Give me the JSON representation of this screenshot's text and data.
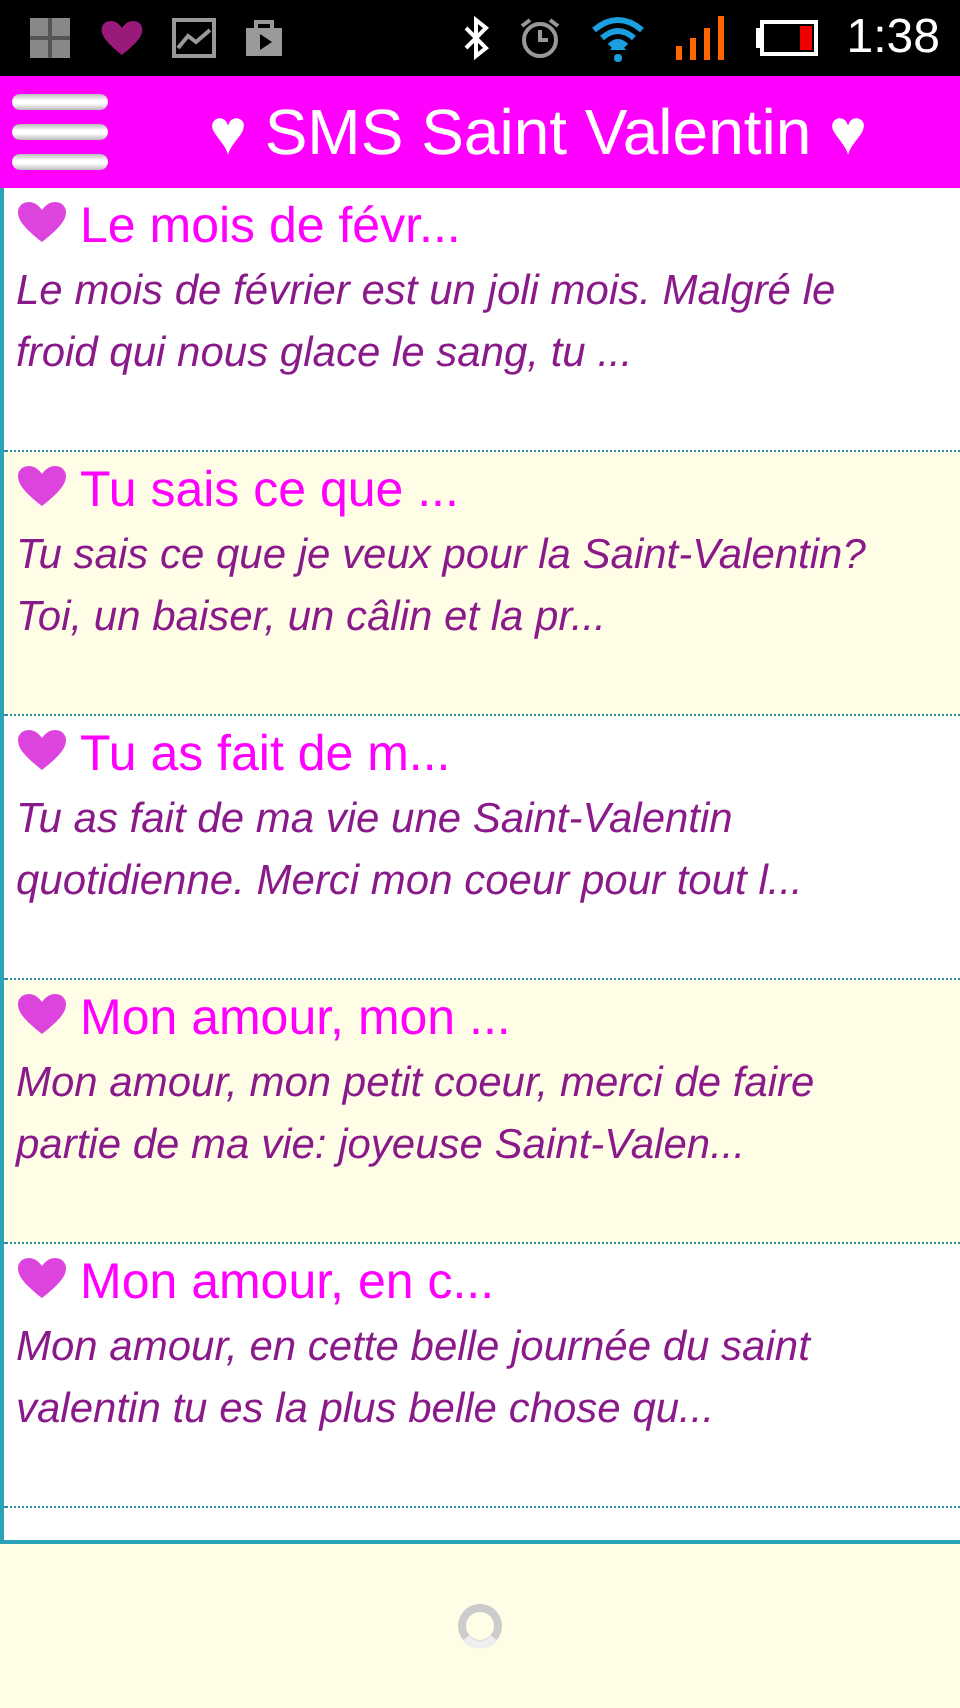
{
  "status_bar": {
    "time": "1:38"
  },
  "header": {
    "title": "♥ SMS Saint Valentin ♥"
  },
  "messages": [
    {
      "title": "Le mois de févr...",
      "preview": "Le mois de février est un joli mois. Malgré le froid qui nous glace le sang, tu ..."
    },
    {
      "title": "Tu sais ce que ...",
      "preview": "Tu sais ce que je veux pour la Saint-Valentin? Toi, un baiser, un câlin et la pr..."
    },
    {
      "title": "Tu as fait de m...",
      "preview": "Tu as fait de ma vie une Saint-Valentin quotidienne. Merci mon coeur pour tout l..."
    },
    {
      "title": "Mon amour, mon ...",
      "preview": "Mon amour, mon petit coeur, merci de faire partie de ma vie: joyeuse Saint-Valen..."
    },
    {
      "title": "Mon amour, en c...",
      "preview": "Mon amour, en cette belle journée du saint valentin tu es la plus belle chose qu..."
    }
  ]
}
